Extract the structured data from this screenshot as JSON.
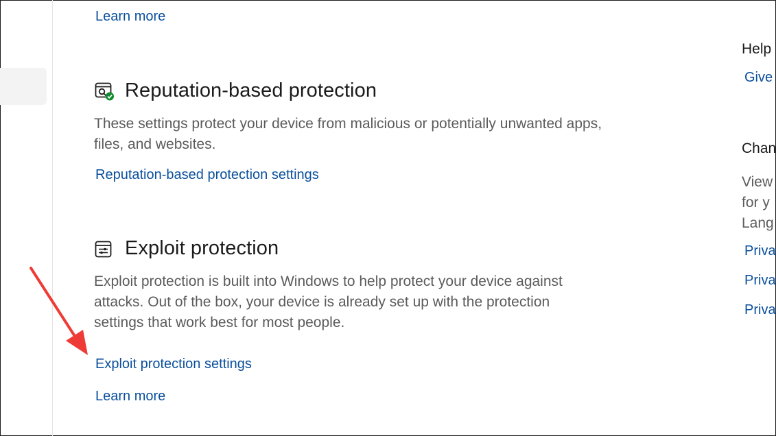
{
  "top_learn_more": "Learn more",
  "reputation": {
    "icon": "app-browser-shield-icon",
    "title": "Reputation-based protection",
    "description": "These settings protect your device from malicious or potentially unwanted apps, files, and websites.",
    "settings_link": "Reputation-based protection settings"
  },
  "exploit": {
    "icon": "exploit-protection-icon",
    "title": "Exploit protection",
    "description": "Exploit protection is built into Windows to help protect your device against attacks.  Out of the box, your device is already set up with the protection settings that work best for most people.",
    "settings_link": "Exploit protection settings",
    "learn_more": "Learn more"
  },
  "right_panel": {
    "help_heading": "Help",
    "give_link": "Give",
    "change_heading": "Chan",
    "view_lines": [
      "View",
      "for y",
      "Lang"
    ],
    "privacy_links": [
      "Priva",
      "Priva",
      "Priva"
    ]
  },
  "annotation": {
    "arrow_color": "#ef3b36"
  },
  "colors": {
    "link": "#0a4f9c",
    "text": "#1b1b1b",
    "muted": "#5b5b5b",
    "accent_check": "#0f8a2f"
  }
}
